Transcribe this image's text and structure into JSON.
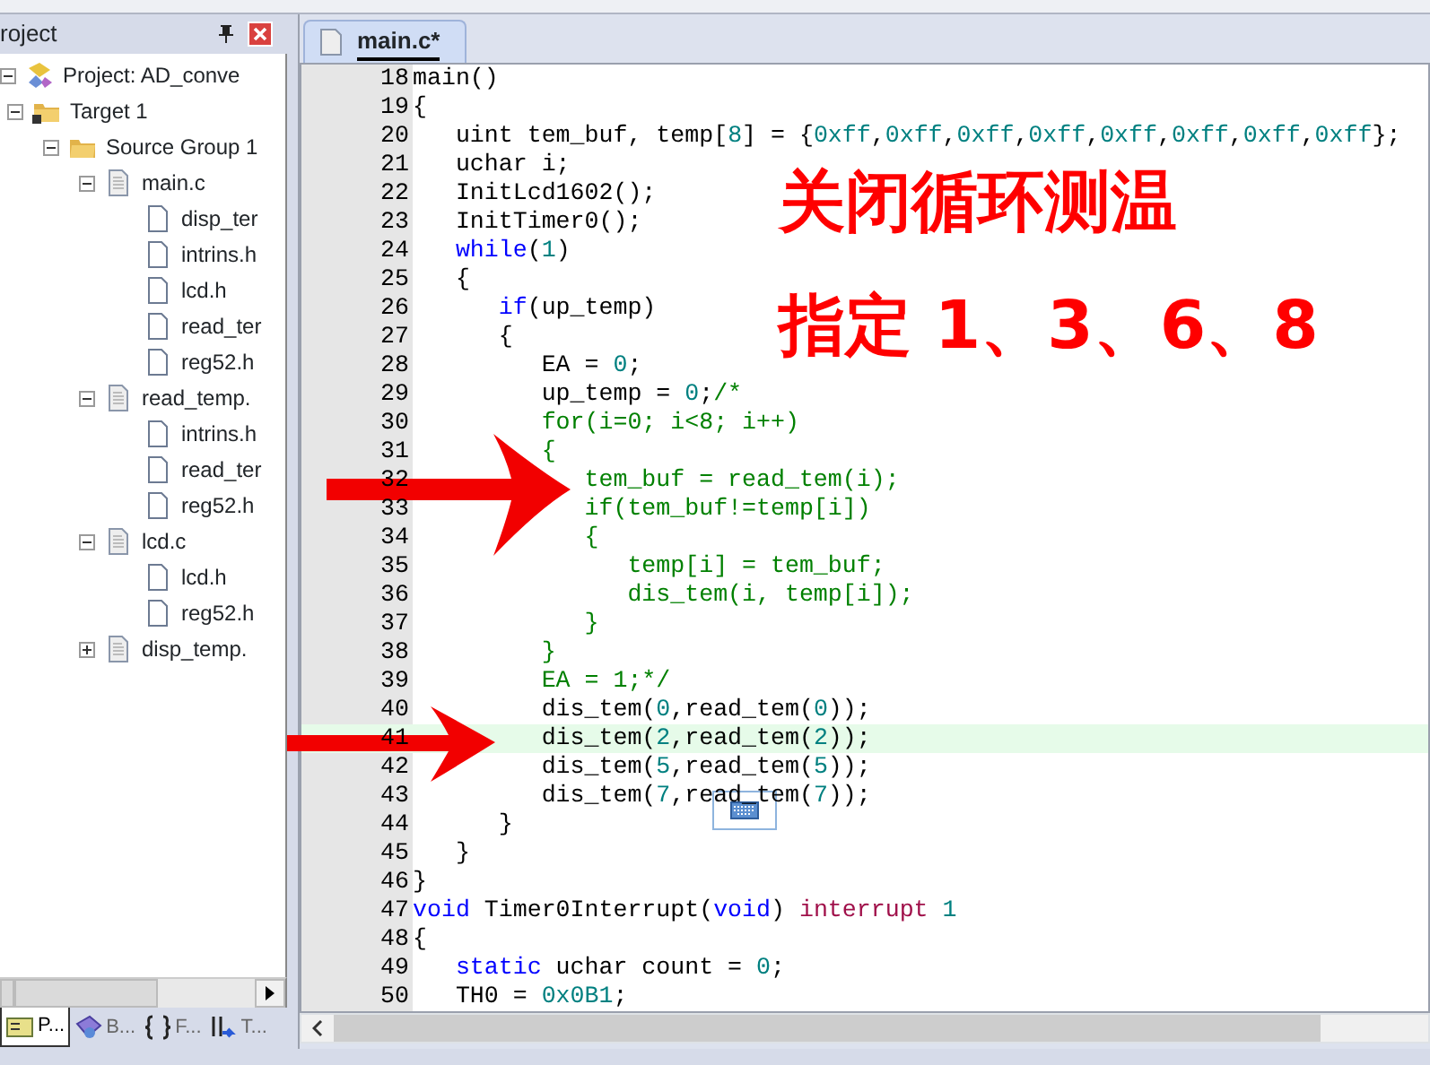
{
  "project_panel": {
    "title": "roject",
    "tree": [
      {
        "label": "Project: AD_conve",
        "kind": "project",
        "expanded": true,
        "children": [
          {
            "label": "Target 1",
            "kind": "target",
            "expanded": true,
            "children": [
              {
                "label": "Source Group 1",
                "kind": "folder",
                "expanded": true,
                "children": [
                  {
                    "label": "main.c",
                    "kind": "source",
                    "expanded": true,
                    "children": [
                      {
                        "label": "disp_ter",
                        "kind": "header"
                      },
                      {
                        "label": "intrins.h",
                        "kind": "header"
                      },
                      {
                        "label": "lcd.h",
                        "kind": "header"
                      },
                      {
                        "label": "read_ter",
                        "kind": "header"
                      },
                      {
                        "label": "reg52.h",
                        "kind": "header"
                      }
                    ]
                  },
                  {
                    "label": "read_temp.",
                    "kind": "source",
                    "expanded": true,
                    "children": [
                      {
                        "label": "intrins.h",
                        "kind": "header"
                      },
                      {
                        "label": "read_ter",
                        "kind": "header"
                      },
                      {
                        "label": "reg52.h",
                        "kind": "header"
                      }
                    ]
                  },
                  {
                    "label": "lcd.c",
                    "kind": "source",
                    "expanded": true,
                    "children": [
                      {
                        "label": "lcd.h",
                        "kind": "header"
                      },
                      {
                        "label": "reg52.h",
                        "kind": "header"
                      }
                    ]
                  },
                  {
                    "label": "disp_temp.",
                    "kind": "source",
                    "expanded": false
                  }
                ]
              }
            ]
          }
        ]
      }
    ],
    "tabs": [
      {
        "label": "P...",
        "kind": "project",
        "selected": true
      },
      {
        "label": "B...",
        "kind": "books",
        "selected": false
      },
      {
        "label": "F...",
        "kind": "functions",
        "selected": false
      },
      {
        "label": "T...",
        "kind": "templates",
        "selected": false
      }
    ]
  },
  "editor": {
    "tab": {
      "label": "main.c*",
      "selected": true
    },
    "lines": [
      {
        "number": "18",
        "current": false,
        "segments": [
          {
            "kind": "plain",
            "text": "main()"
          }
        ]
      },
      {
        "number": "19",
        "current": false,
        "segments": [
          {
            "kind": "plain",
            "text": "{"
          }
        ]
      },
      {
        "number": "20",
        "current": false,
        "segments": [
          {
            "kind": "plain",
            "text": "   uint tem_buf, temp["
          },
          {
            "kind": "number",
            "text": "8"
          },
          {
            "kind": "plain",
            "text": "] = {"
          },
          {
            "kind": "number",
            "text": "0xff"
          },
          {
            "kind": "plain",
            "text": ","
          },
          {
            "kind": "number",
            "text": "0xff"
          },
          {
            "kind": "plain",
            "text": ","
          },
          {
            "kind": "number",
            "text": "0xff"
          },
          {
            "kind": "plain",
            "text": ","
          },
          {
            "kind": "number",
            "text": "0xff"
          },
          {
            "kind": "plain",
            "text": ","
          },
          {
            "kind": "number",
            "text": "0xff"
          },
          {
            "kind": "plain",
            "text": ","
          },
          {
            "kind": "number",
            "text": "0xff"
          },
          {
            "kind": "plain",
            "text": ","
          },
          {
            "kind": "number",
            "text": "0xff"
          },
          {
            "kind": "plain",
            "text": ","
          },
          {
            "kind": "number",
            "text": "0xff"
          },
          {
            "kind": "plain",
            "text": "};"
          }
        ]
      },
      {
        "number": "21",
        "current": false,
        "segments": [
          {
            "kind": "plain",
            "text": "   uchar i;"
          }
        ]
      },
      {
        "number": "22",
        "current": false,
        "segments": [
          {
            "kind": "plain",
            "text": "   InitLcd1602();"
          }
        ]
      },
      {
        "number": "23",
        "current": false,
        "segments": [
          {
            "kind": "plain",
            "text": "   InitTimer0();"
          }
        ]
      },
      {
        "number": "24",
        "current": false,
        "segments": [
          {
            "kind": "keyword",
            "text": "   while"
          },
          {
            "kind": "plain",
            "text": "("
          },
          {
            "kind": "number",
            "text": "1"
          },
          {
            "kind": "plain",
            "text": ")"
          }
        ]
      },
      {
        "number": "25",
        "current": false,
        "segments": [
          {
            "kind": "plain",
            "text": "   {"
          }
        ]
      },
      {
        "number": "26",
        "current": false,
        "segments": [
          {
            "kind": "keyword",
            "text": "      if"
          },
          {
            "kind": "plain",
            "text": "(up_temp)"
          }
        ]
      },
      {
        "number": "27",
        "current": false,
        "segments": [
          {
            "kind": "plain",
            "text": "      {"
          }
        ]
      },
      {
        "number": "28",
        "current": false,
        "segments": [
          {
            "kind": "plain",
            "text": "         EA = "
          },
          {
            "kind": "number",
            "text": "0"
          },
          {
            "kind": "plain",
            "text": ";"
          }
        ]
      },
      {
        "number": "29",
        "current": false,
        "segments": [
          {
            "kind": "plain",
            "text": "         up_temp = "
          },
          {
            "kind": "number",
            "text": "0"
          },
          {
            "kind": "plain",
            "text": ";"
          },
          {
            "kind": "comment",
            "text": "/*"
          }
        ]
      },
      {
        "number": "30",
        "current": false,
        "segments": [
          {
            "kind": "comment",
            "text": "         for(i=0; i<8; i++)"
          }
        ]
      },
      {
        "number": "31",
        "current": false,
        "segments": [
          {
            "kind": "comment",
            "text": "         {"
          }
        ]
      },
      {
        "number": "32",
        "current": false,
        "segments": [
          {
            "kind": "comment",
            "text": "            tem_buf = read_tem(i);"
          }
        ]
      },
      {
        "number": "33",
        "current": false,
        "segments": [
          {
            "kind": "comment",
            "text": "            if(tem_buf!=temp[i])"
          }
        ]
      },
      {
        "number": "34",
        "current": false,
        "segments": [
          {
            "kind": "comment",
            "text": "            {"
          }
        ]
      },
      {
        "number": "35",
        "current": false,
        "segments": [
          {
            "kind": "comment",
            "text": "               temp[i] = tem_buf;"
          }
        ]
      },
      {
        "number": "36",
        "current": false,
        "segments": [
          {
            "kind": "comment",
            "text": "               dis_tem(i, temp[i]);"
          }
        ]
      },
      {
        "number": "37",
        "current": false,
        "segments": [
          {
            "kind": "comment",
            "text": "            }"
          }
        ]
      },
      {
        "number": "38",
        "current": false,
        "segments": [
          {
            "kind": "comment",
            "text": "         }"
          }
        ]
      },
      {
        "number": "39",
        "current": false,
        "segments": [
          {
            "kind": "comment",
            "text": "         EA = 1;*/"
          }
        ]
      },
      {
        "number": "40",
        "current": false,
        "segments": [
          {
            "kind": "plain",
            "text": "         dis_tem("
          },
          {
            "kind": "number",
            "text": "0"
          },
          {
            "kind": "plain",
            "text": ",read_tem("
          },
          {
            "kind": "number",
            "text": "0"
          },
          {
            "kind": "plain",
            "text": "));"
          }
        ]
      },
      {
        "number": "41",
        "current": true,
        "segments": [
          {
            "kind": "plain",
            "text": "         dis_tem("
          },
          {
            "kind": "number",
            "text": "2"
          },
          {
            "kind": "plain",
            "text": ",read_tem("
          },
          {
            "kind": "number",
            "text": "2"
          },
          {
            "kind": "plain",
            "text": "));"
          }
        ]
      },
      {
        "number": "42",
        "current": false,
        "segments": [
          {
            "kind": "plain",
            "text": "         dis_tem("
          },
          {
            "kind": "number",
            "text": "5"
          },
          {
            "kind": "plain",
            "text": ",read_tem("
          },
          {
            "kind": "number",
            "text": "5"
          },
          {
            "kind": "plain",
            "text": "));"
          }
        ]
      },
      {
        "number": "43",
        "current": false,
        "segments": [
          {
            "kind": "plain",
            "text": "         dis_tem("
          },
          {
            "kind": "number",
            "text": "7"
          },
          {
            "kind": "plain",
            "text": ",read_tem("
          },
          {
            "kind": "number",
            "text": "7"
          },
          {
            "kind": "plain",
            "text": "));"
          }
        ]
      },
      {
        "number": "44",
        "current": false,
        "segments": [
          {
            "kind": "plain",
            "text": "      }"
          }
        ]
      },
      {
        "number": "45",
        "current": false,
        "segments": [
          {
            "kind": "plain",
            "text": "   }"
          }
        ]
      },
      {
        "number": "46",
        "current": false,
        "segments": [
          {
            "kind": "plain",
            "text": "}"
          }
        ]
      },
      {
        "number": "47",
        "current": false,
        "segments": [
          {
            "kind": "keyword",
            "text": "void"
          },
          {
            "kind": "plain",
            "text": " Timer0Interrupt("
          },
          {
            "kind": "keyword",
            "text": "void"
          },
          {
            "kind": "plain",
            "text": ") "
          },
          {
            "kind": "special",
            "text": "interrupt"
          },
          {
            "kind": "number",
            "text": " 1"
          }
        ]
      },
      {
        "number": "48",
        "current": false,
        "segments": [
          {
            "kind": "plain",
            "text": "{"
          }
        ]
      },
      {
        "number": "49",
        "current": false,
        "segments": [
          {
            "kind": "keyword",
            "text": "   static"
          },
          {
            "kind": "plain",
            "text": " uchar count = "
          },
          {
            "kind": "number",
            "text": "0"
          },
          {
            "kind": "plain",
            "text": ";"
          }
        ]
      },
      {
        "number": "50",
        "current": false,
        "segments": [
          {
            "kind": "plain",
            "text": "   TH0 = "
          },
          {
            "kind": "number",
            "text": "0x0B1"
          },
          {
            "kind": "plain",
            "text": ";"
          }
        ]
      }
    ]
  },
  "annotations": [
    "关闭循环测温",
    "指定 1、3、6、8"
  ]
}
